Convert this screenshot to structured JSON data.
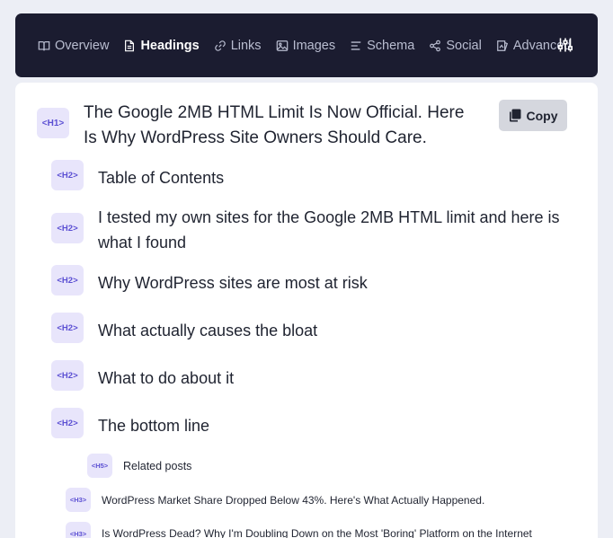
{
  "nav": {
    "tabs": [
      {
        "label": "Overview",
        "icon": "book-icon",
        "active": false
      },
      {
        "label": "Headings",
        "icon": "document-icon",
        "active": true
      },
      {
        "label": "Links",
        "icon": "link-icon",
        "active": false
      },
      {
        "label": "Images",
        "icon": "image-icon",
        "active": false
      },
      {
        "label": "Schema",
        "icon": "align-left-icon",
        "active": false
      },
      {
        "label": "Social",
        "icon": "share-icon",
        "active": false
      },
      {
        "label": "Advanced",
        "icon": "flask-icon",
        "active": false
      }
    ],
    "settings_icon": "sliders-icon"
  },
  "colors": {
    "nav_bg": "#1b1c30",
    "badge_bg": "#e8e5fb",
    "badge_text": "#5b4fd3",
    "page_bg": "#eceef5"
  },
  "headings": [
    {
      "level": "<H1>",
      "text": "The Google 2MB HTML Limit Is Now Official. Here Is Why WordPress Site Owners Should Care."
    },
    {
      "level": "<H2>",
      "text": "Table of Contents"
    },
    {
      "level": "<H2>",
      "text": "I tested my own sites for the Google 2MB HTML limit and here is what I found"
    },
    {
      "level": "<H2>",
      "text": "Why WordPress sites are most at risk"
    },
    {
      "level": "<H2>",
      "text": "What actually causes the bloat"
    },
    {
      "level": "<H2>",
      "text": "What to do about it"
    },
    {
      "level": "<H2>",
      "text": "The bottom line"
    },
    {
      "level": "<H5>",
      "text": "Related posts"
    },
    {
      "level": "<H3>",
      "text": "WordPress Market Share Dropped Below 43%. Here's What Actually Happened."
    },
    {
      "level": "<H3>",
      "text": "Is WordPress Dead? Why I'm Doubling Down on the Most 'Boring' Platform on the Internet"
    }
  ],
  "copy_button": {
    "label": "Copy",
    "icon": "clipboard-icon"
  }
}
